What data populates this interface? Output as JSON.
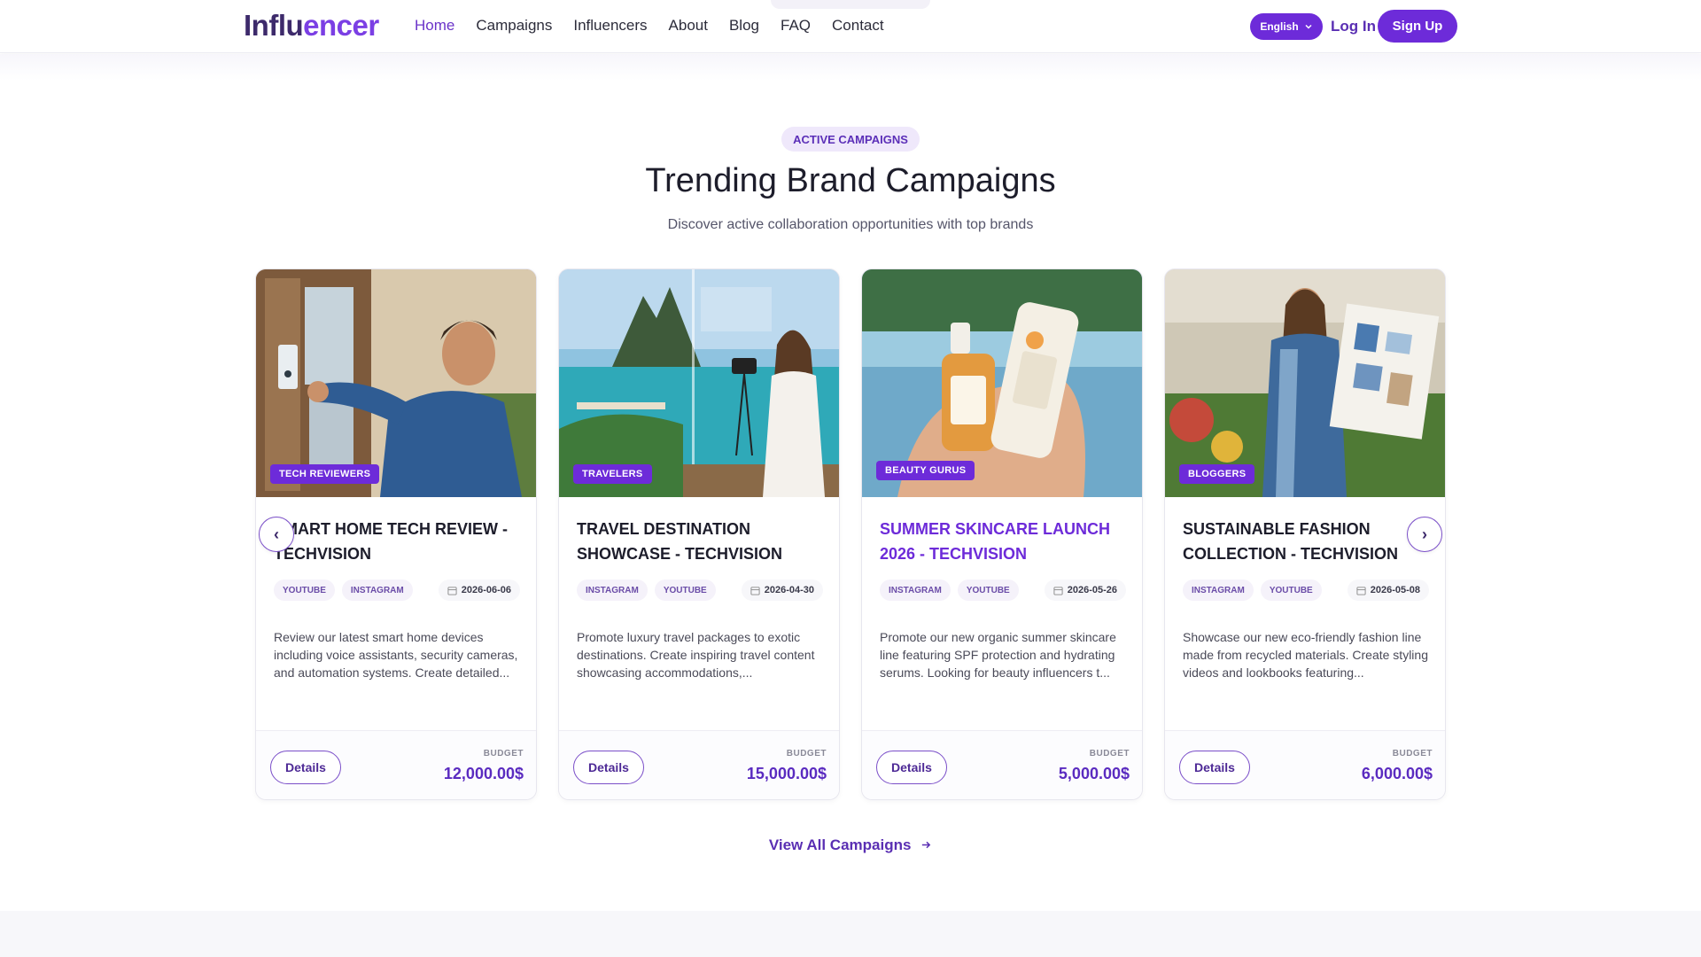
{
  "header": {
    "logo_part1": "Influ",
    "logo_part2": "encer",
    "nav": [
      "Home",
      "Campaigns",
      "Influencers",
      "About",
      "Blog",
      "FAQ",
      "Contact"
    ],
    "active_nav": "Home",
    "language": "English",
    "login": "Log In",
    "signup": "Sign Up"
  },
  "section": {
    "badge": "ACTIVE CAMPAIGNS",
    "title": "Trending Brand Campaigns",
    "subtitle": "Discover active collaboration opportunities with top brands",
    "view_all": "View All Campaigns"
  },
  "colors": {
    "accent": "#6d2bd9",
    "accent_dark": "#3d2a6b"
  },
  "carousel": {
    "prev_icon": "chevron-left-icon",
    "next_icon": "chevron-right-icon",
    "prev": "‹",
    "next": "›"
  },
  "cards": [
    {
      "category": "TECH REVIEWERS",
      "title": "Smart Home Tech Review - TechVision",
      "tags": [
        "YOUTUBE",
        "INSTAGRAM"
      ],
      "date": "2026-06-06",
      "description": "Review our latest smart home devices including voice assistants, security cameras, and automation systems. Create detailed...",
      "details": "Details",
      "budget_label": "BUDGET",
      "budget": "12,000.00$"
    },
    {
      "category": "TRAVELERS",
      "title": "Travel Destination Showcase - TechVision",
      "tags": [
        "INSTAGRAM",
        "YOUTUBE"
      ],
      "date": "2026-04-30",
      "description": "Promote luxury travel packages to exotic destinations. Create inspiring travel content showcasing accommodations,...",
      "details": "Details",
      "budget_label": "BUDGET",
      "budget": "15,000.00$"
    },
    {
      "category": "BEAUTY GURUS",
      "title": "Summer Skincare Launch 2026 - TechVision",
      "tags": [
        "INSTAGRAM",
        "YOUTUBE"
      ],
      "date": "2026-05-26",
      "description": "Promote our new organic summer skincare line featuring SPF protection and hydrating serums. Looking for beauty influencers t...",
      "details": "Details",
      "budget_label": "BUDGET",
      "budget": "5,000.00$"
    },
    {
      "category": "BLOGGERS",
      "title": "Sustainable Fashion Collection - TechVision",
      "tags": [
        "INSTAGRAM",
        "YOUTUBE"
      ],
      "date": "2026-05-08",
      "description": "Showcase our new eco-friendly fashion line made from recycled materials. Create styling videos and lookbooks featuring...",
      "details": "Details",
      "budget_label": "BUDGET",
      "budget": "6,000.00$"
    }
  ]
}
